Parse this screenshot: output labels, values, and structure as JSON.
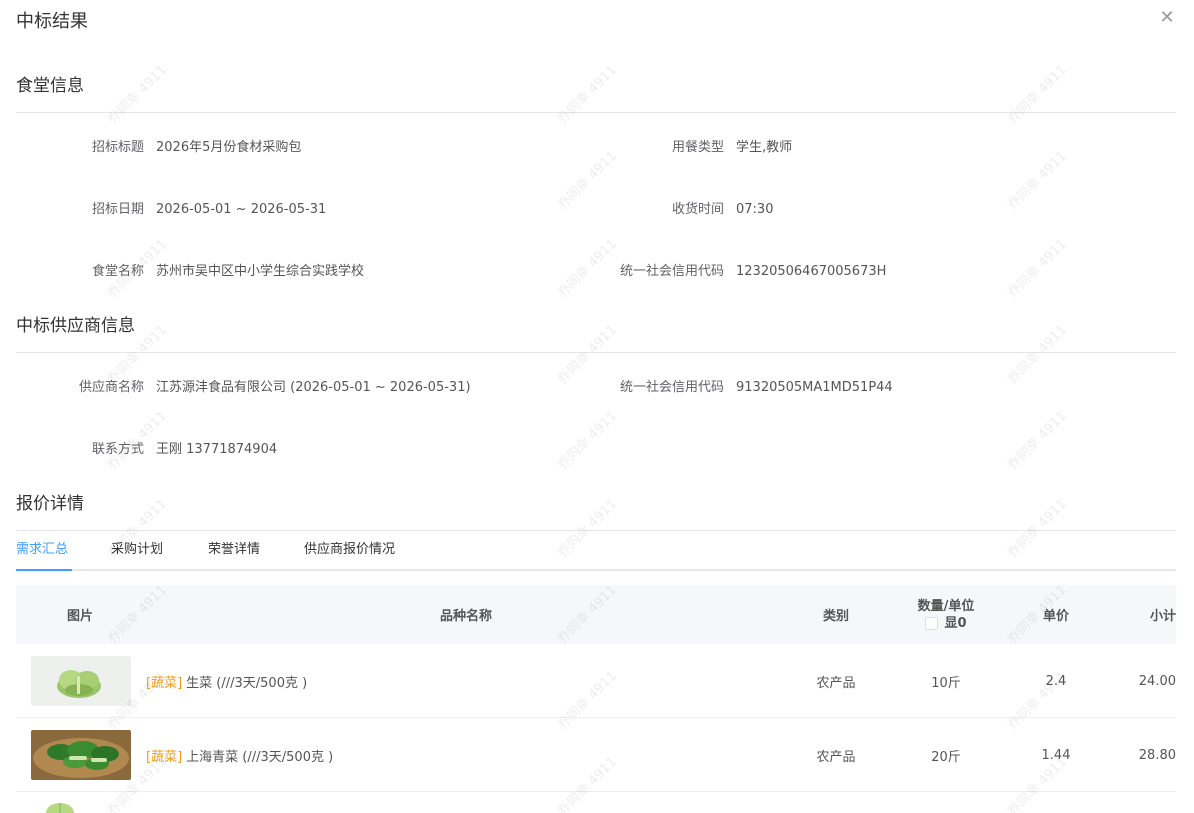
{
  "dialog": {
    "title": "中标结果",
    "close_icon": "close-icon"
  },
  "canteen": {
    "section_title": "食堂信息",
    "fields": [
      {
        "label": "招标标题",
        "value": "2026年5月份食材采购包"
      },
      {
        "label": "用餐类型",
        "value": "学生,教师"
      },
      {
        "label": "招标日期",
        "value": "2026-05-01 ~ 2026-05-31"
      },
      {
        "label": "收货时间",
        "value": "07:30"
      },
      {
        "label": "食堂名称",
        "value": "苏州市吴中区中小学生综合实践学校"
      },
      {
        "label": "统一社会信用代码",
        "value": "12320506467005673H"
      }
    ]
  },
  "supplier": {
    "section_title": "中标供应商信息",
    "fields": [
      {
        "label": "供应商名称",
        "value": "江苏源沣食品有限公司 (2026-05-01 ~ 2026-05-31)"
      },
      {
        "label": "统一社会信用代码",
        "value": "91320505MA1MD51P44"
      },
      {
        "label": "联系方式",
        "value": "王刚 13771874904"
      }
    ]
  },
  "quote": {
    "section_title": "报价详情",
    "tabs": [
      {
        "label": "需求汇总",
        "active": true
      },
      {
        "label": "采购计划",
        "active": false
      },
      {
        "label": "荣誉详情",
        "active": false
      },
      {
        "label": "供应商报价情况",
        "active": false
      }
    ],
    "table": {
      "headers": {
        "image": "图片",
        "name": "品种名称",
        "category": "类别",
        "qty_line1": "数量/单位",
        "qty_line2": "显0",
        "price": "单价",
        "subtotal": "小计"
      },
      "rows": [
        {
          "tag": "[蔬菜]",
          "name": "生菜 (///3天/500克 )",
          "category": "农产品",
          "qty": "10斤",
          "price": "2.4",
          "subtotal": "24.00"
        },
        {
          "tag": "[蔬菜]",
          "name": "上海青菜 (///3天/500克 )",
          "category": "农产品",
          "qty": "20斤",
          "price": "1.44",
          "subtotal": "28.80"
        }
      ]
    }
  },
  "watermark_text": "乔同幸 4911",
  "colors": {
    "accent": "#409eff",
    "tag": "#f39c12",
    "header_bg": "#f5f7fa"
  }
}
